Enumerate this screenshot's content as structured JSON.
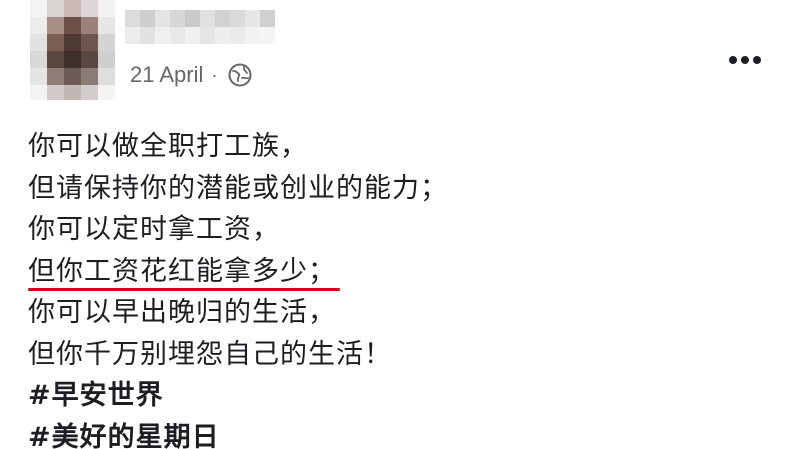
{
  "post": {
    "date": "21 April",
    "separator": "·",
    "privacy_icon": "globe-icon",
    "more_icon": "more-options-icon",
    "lines": [
      "你可以做全职打工族，",
      "但请保持你的潜能或创业的能力；",
      "你可以定时拿工资，",
      "但你工资花红能拿多少；",
      "你可以早出晚归的生活，",
      "但你千万别埋怨自己的生活！"
    ],
    "hashtags": [
      "#早安世界",
      "#美好的星期日"
    ]
  },
  "colors": {
    "underline": "#d0021b",
    "meta_text": "#65676b",
    "body_text": "#1c1e21"
  }
}
